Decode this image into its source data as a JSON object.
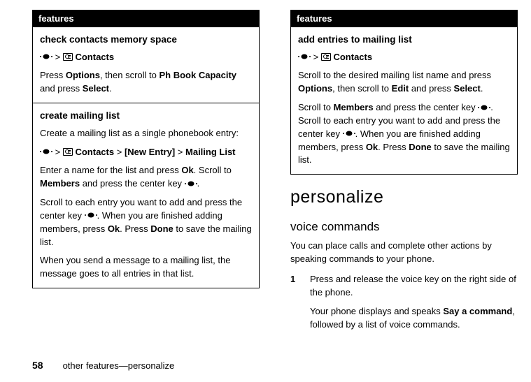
{
  "left": {
    "header": "features",
    "row1": {
      "title": "check contacts memory space",
      "nav_contacts": "Contacts",
      "body1_prefix": "Press ",
      "options": "Options",
      "body1_mid": ", then scroll to ",
      "phbook": "Ph Book Capacity",
      "body1_mid2": " and press ",
      "select": "Select",
      "body1_end": "."
    },
    "row2": {
      "title": "create mailing list",
      "intro": "Create a mailing list as a single phonebook entry:",
      "nav_contacts": "Contacts",
      "nav_new": "[New Entry]",
      "nav_ml": "Mailing List",
      "p2_a": "Enter a name for the list and press ",
      "ok": "Ok",
      "p2_b": ". Scroll to ",
      "members": "Members",
      "p2_c": " and press the center key ",
      "p2_d": ".",
      "p3_a": "Scroll to each entry you want to add and press the center key ",
      "p3_b": ". When you are finished adding members, press ",
      "p3_c": ". Press ",
      "done": "Done",
      "p3_d": " to save the mailing list.",
      "p4": "When you send a message to a mailing list, the message goes to all entries in that list."
    }
  },
  "right": {
    "header": "features",
    "row1": {
      "title": "add entries to mailing list",
      "nav_contacts": "Contacts",
      "p1_a": "Scroll to the desired mailing list name and press ",
      "options": "Options",
      "p1_b": ", then scroll to ",
      "edit": "Edit",
      "p1_c": " and press ",
      "select": "Select",
      "p1_d": ".",
      "p2_a": "Scroll to ",
      "members": "Members",
      "p2_b": " and press the center key ",
      "p2_c": ". Scroll to each entry you want to add and press the center key ",
      "p2_d": ". When you are finished adding members, press ",
      "ok": "Ok",
      "p2_e": ". Press ",
      "done": "Done",
      "p2_f": " to save the mailing list."
    },
    "section_h1": "personalize",
    "section_h2": "voice commands",
    "intro": "You can place calls and complete other actions by speaking commands to your phone.",
    "step1_num": "1",
    "step1_body": "Press and release the voice key on the right side of the phone.",
    "step1_sub_a": "Your phone displays and speaks ",
    "step1_say": "Say a command",
    "step1_sub_b": ", followed by a list of voice commands."
  },
  "footer": {
    "page": "58",
    "text": "other features—personalize"
  }
}
